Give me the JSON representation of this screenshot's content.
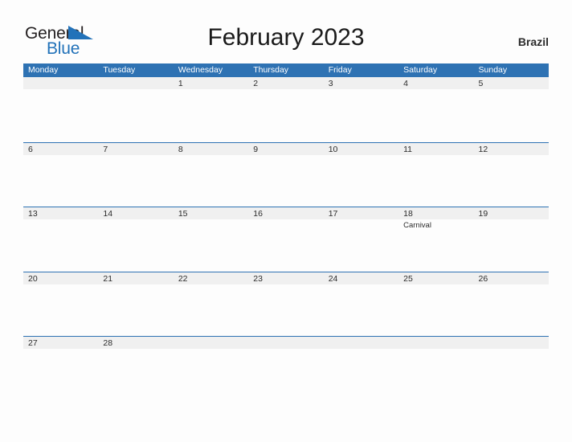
{
  "brand": {
    "name_top": "General",
    "name_bottom": "Blue",
    "flag_icon": "blue-flag-triangle-icon",
    "color_top": "#231f20",
    "color_bottom": "#2272b9"
  },
  "header": {
    "title": "February 2023",
    "country": "Brazil"
  },
  "theme": {
    "header_blue": "#2e72b3",
    "band_gray": "#f0f0f0",
    "rule_blue": "#2e72b3",
    "page_background": "#fdfdfd",
    "text": "#2b2b2b"
  },
  "calendar": {
    "month": "February",
    "year": "2023",
    "weekday_headers": [
      "Monday",
      "Tuesday",
      "Wednesday",
      "Thursday",
      "Friday",
      "Saturday",
      "Sunday"
    ],
    "weeks": [
      {
        "days": [
          {
            "num": "",
            "events": []
          },
          {
            "num": "",
            "events": []
          },
          {
            "num": "1",
            "events": []
          },
          {
            "num": "2",
            "events": []
          },
          {
            "num": "3",
            "events": []
          },
          {
            "num": "4",
            "events": []
          },
          {
            "num": "5",
            "events": []
          }
        ]
      },
      {
        "days": [
          {
            "num": "6",
            "events": []
          },
          {
            "num": "7",
            "events": []
          },
          {
            "num": "8",
            "events": []
          },
          {
            "num": "9",
            "events": []
          },
          {
            "num": "10",
            "events": []
          },
          {
            "num": "11",
            "events": []
          },
          {
            "num": "12",
            "events": []
          }
        ]
      },
      {
        "days": [
          {
            "num": "13",
            "events": []
          },
          {
            "num": "14",
            "events": []
          },
          {
            "num": "15",
            "events": []
          },
          {
            "num": "16",
            "events": []
          },
          {
            "num": "17",
            "events": []
          },
          {
            "num": "18",
            "events": [
              "Carnival"
            ]
          },
          {
            "num": "19",
            "events": []
          }
        ]
      },
      {
        "days": [
          {
            "num": "20",
            "events": []
          },
          {
            "num": "21",
            "events": []
          },
          {
            "num": "22",
            "events": []
          },
          {
            "num": "23",
            "events": []
          },
          {
            "num": "24",
            "events": []
          },
          {
            "num": "25",
            "events": []
          },
          {
            "num": "26",
            "events": []
          }
        ]
      },
      {
        "days": [
          {
            "num": "27",
            "events": []
          },
          {
            "num": "28",
            "events": []
          },
          {
            "num": "",
            "events": []
          },
          {
            "num": "",
            "events": []
          },
          {
            "num": "",
            "events": []
          },
          {
            "num": "",
            "events": []
          },
          {
            "num": "",
            "events": []
          }
        ]
      }
    ]
  }
}
